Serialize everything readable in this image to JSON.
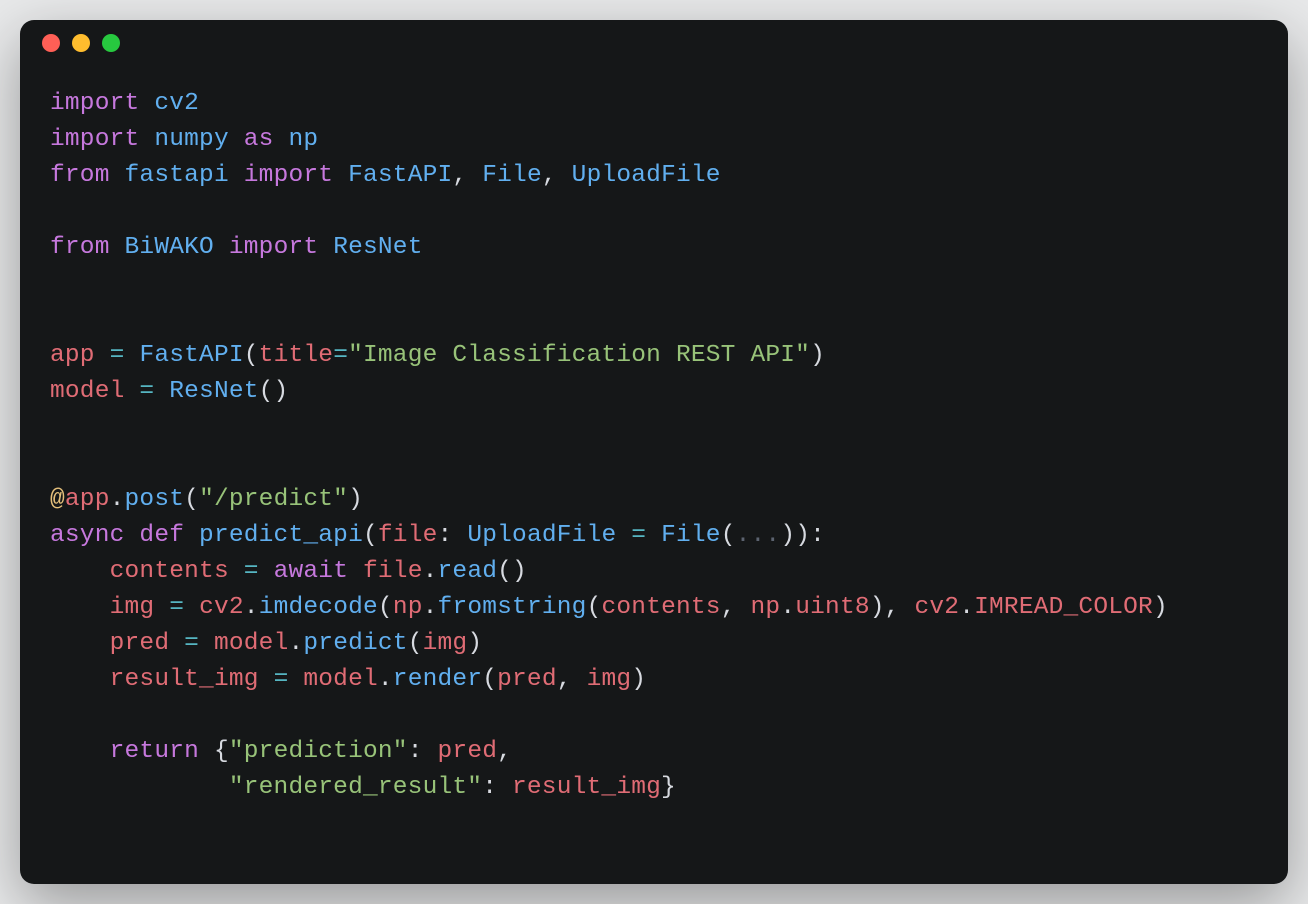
{
  "window": {
    "traffic_lights": [
      "close",
      "minimize",
      "zoom"
    ]
  },
  "code": {
    "tokens": [
      [
        [
          "kw-purple",
          "import"
        ],
        [
          "punct-lt",
          " "
        ],
        [
          "ident-blue",
          "cv2"
        ]
      ],
      [
        [
          "kw-purple",
          "import"
        ],
        [
          "punct-lt",
          " "
        ],
        [
          "ident-blue",
          "numpy"
        ],
        [
          "punct-lt",
          " "
        ],
        [
          "kw-purple",
          "as"
        ],
        [
          "punct-lt",
          " "
        ],
        [
          "ident-blue",
          "np"
        ]
      ],
      [
        [
          "kw-purple",
          "from"
        ],
        [
          "punct-lt",
          " "
        ],
        [
          "ident-blue",
          "fastapi"
        ],
        [
          "punct-lt",
          " "
        ],
        [
          "kw-purple",
          "import"
        ],
        [
          "punct-lt",
          " "
        ],
        [
          "ident-blue",
          "FastAPI"
        ],
        [
          "punct-w",
          ", "
        ],
        [
          "ident-blue",
          "File"
        ],
        [
          "punct-w",
          ", "
        ],
        [
          "ident-blue",
          "UploadFile"
        ]
      ],
      [],
      [
        [
          "kw-purple",
          "from"
        ],
        [
          "punct-lt",
          " "
        ],
        [
          "ident-blue",
          "BiWAKO"
        ],
        [
          "punct-lt",
          " "
        ],
        [
          "kw-purple",
          "import"
        ],
        [
          "punct-lt",
          " "
        ],
        [
          "ident-blue",
          "ResNet"
        ]
      ],
      [],
      [],
      [
        [
          "ident-red",
          "app"
        ],
        [
          "punct-lt",
          " "
        ],
        [
          "ident-teal",
          "="
        ],
        [
          "punct-lt",
          " "
        ],
        [
          "ident-blue",
          "FastAPI"
        ],
        [
          "punct-w",
          "("
        ],
        [
          "ident-red",
          "title"
        ],
        [
          "ident-teal",
          "="
        ],
        [
          "str-green",
          "\"Image Classification REST API\""
        ],
        [
          "punct-w",
          ")"
        ]
      ],
      [
        [
          "ident-red",
          "model"
        ],
        [
          "punct-lt",
          " "
        ],
        [
          "ident-teal",
          "="
        ],
        [
          "punct-lt",
          " "
        ],
        [
          "ident-blue",
          "ResNet"
        ],
        [
          "punct-w",
          "()"
        ]
      ],
      [],
      [],
      [
        [
          "op-yellow",
          "@"
        ],
        [
          "ident-red",
          "app"
        ],
        [
          "punct-w",
          "."
        ],
        [
          "ident-blue",
          "post"
        ],
        [
          "punct-w",
          "("
        ],
        [
          "str-green",
          "\"/predict\""
        ],
        [
          "punct-w",
          ")"
        ]
      ],
      [
        [
          "kw-purple",
          "async"
        ],
        [
          "punct-lt",
          " "
        ],
        [
          "kw-purple",
          "def"
        ],
        [
          "punct-lt",
          " "
        ],
        [
          "ident-blue",
          "predict_api"
        ],
        [
          "punct-w",
          "("
        ],
        [
          "ident-red",
          "file"
        ],
        [
          "punct-w",
          ": "
        ],
        [
          "ident-blue",
          "UploadFile"
        ],
        [
          "punct-lt",
          " "
        ],
        [
          "ident-teal",
          "="
        ],
        [
          "punct-lt",
          " "
        ],
        [
          "ident-blue",
          "File"
        ],
        [
          "punct-w",
          "("
        ],
        [
          "punct-d",
          "..."
        ],
        [
          "punct-w",
          "))"
        ],
        [
          "punct-w",
          ":"
        ]
      ],
      [
        [
          "punct-lt",
          "    "
        ],
        [
          "ident-red",
          "contents"
        ],
        [
          "punct-lt",
          " "
        ],
        [
          "ident-teal",
          "="
        ],
        [
          "punct-lt",
          " "
        ],
        [
          "kw-purple",
          "await"
        ],
        [
          "punct-lt",
          " "
        ],
        [
          "ident-red",
          "file"
        ],
        [
          "punct-w",
          "."
        ],
        [
          "ident-blue",
          "read"
        ],
        [
          "punct-w",
          "()"
        ]
      ],
      [
        [
          "punct-lt",
          "    "
        ],
        [
          "ident-red",
          "img"
        ],
        [
          "punct-lt",
          " "
        ],
        [
          "ident-teal",
          "="
        ],
        [
          "punct-lt",
          " "
        ],
        [
          "ident-red",
          "cv2"
        ],
        [
          "punct-w",
          "."
        ],
        [
          "ident-blue",
          "imdecode"
        ],
        [
          "punct-w",
          "("
        ],
        [
          "ident-red",
          "np"
        ],
        [
          "punct-w",
          "."
        ],
        [
          "ident-blue",
          "fromstring"
        ],
        [
          "punct-w",
          "("
        ],
        [
          "ident-red",
          "contents"
        ],
        [
          "punct-w",
          ", "
        ],
        [
          "ident-red",
          "np"
        ],
        [
          "punct-w",
          "."
        ],
        [
          "ident-red",
          "uint8"
        ],
        [
          "punct-w",
          "), "
        ],
        [
          "ident-red",
          "cv2"
        ],
        [
          "punct-w",
          "."
        ],
        [
          "ident-red",
          "IMREAD_COLOR"
        ],
        [
          "punct-w",
          ")"
        ]
      ],
      [
        [
          "punct-lt",
          "    "
        ],
        [
          "ident-red",
          "pred"
        ],
        [
          "punct-lt",
          " "
        ],
        [
          "ident-teal",
          "="
        ],
        [
          "punct-lt",
          " "
        ],
        [
          "ident-red",
          "model"
        ],
        [
          "punct-w",
          "."
        ],
        [
          "ident-blue",
          "predict"
        ],
        [
          "punct-w",
          "("
        ],
        [
          "ident-red",
          "img"
        ],
        [
          "punct-w",
          ")"
        ]
      ],
      [
        [
          "punct-lt",
          "    "
        ],
        [
          "ident-red",
          "result_img"
        ],
        [
          "punct-lt",
          " "
        ],
        [
          "ident-teal",
          "="
        ],
        [
          "punct-lt",
          " "
        ],
        [
          "ident-red",
          "model"
        ],
        [
          "punct-w",
          "."
        ],
        [
          "ident-blue",
          "render"
        ],
        [
          "punct-w",
          "("
        ],
        [
          "ident-red",
          "pred"
        ],
        [
          "punct-w",
          ", "
        ],
        [
          "ident-red",
          "img"
        ],
        [
          "punct-w",
          ")"
        ]
      ],
      [],
      [
        [
          "punct-lt",
          "    "
        ],
        [
          "kw-purple",
          "return"
        ],
        [
          "punct-lt",
          " "
        ],
        [
          "punct-w",
          "{"
        ],
        [
          "str-green",
          "\"prediction\""
        ],
        [
          "punct-w",
          ": "
        ],
        [
          "ident-red",
          "pred"
        ],
        [
          "punct-w",
          ","
        ]
      ],
      [
        [
          "punct-lt",
          "            "
        ],
        [
          "str-green",
          "\"rendered_result\""
        ],
        [
          "punct-w",
          ": "
        ],
        [
          "ident-red",
          "result_img"
        ],
        [
          "punct-w",
          "}"
        ]
      ]
    ]
  }
}
